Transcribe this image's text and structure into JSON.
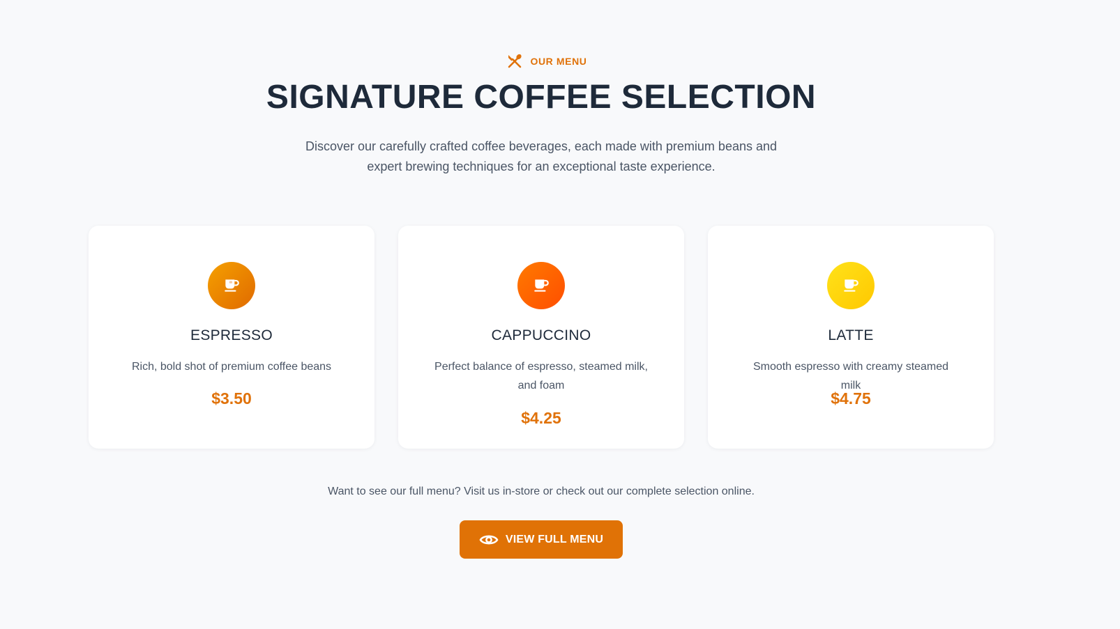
{
  "header": {
    "eyebrow_icon": "utensils-icon",
    "eyebrow": "OUR MENU",
    "title": "SIGNATURE COFFEE SELECTION",
    "subtitle": "Discover our carefully crafted coffee beverages, each made with premium beans and expert brewing techniques for an exceptional taste experience."
  },
  "menu": {
    "items": [
      {
        "icon": "coffee-cup-icon",
        "icon_colors": [
          "#f5a000",
          "#e06a00"
        ],
        "name": "ESPRESSO",
        "description": "Rich, bold shot of premium coffee beans",
        "price": "$3.50"
      },
      {
        "icon": "coffee-cup-icon",
        "icon_colors": [
          "#ff7a00",
          "#ff4e00"
        ],
        "name": "CAPPUCCINO",
        "description": "Perfect balance of espresso, steamed milk, and foam",
        "price": "$4.25"
      },
      {
        "icon": "coffee-cup-icon",
        "icon_colors": [
          "#ffe21a",
          "#ffc800"
        ],
        "name": "LATTE",
        "description": "Smooth espresso with creamy steamed milk",
        "price": "$4.75"
      }
    ]
  },
  "cta": {
    "text": "Want to see our full menu? Visit us in-store or check out our complete selection online.",
    "button_icon": "eye-icon",
    "button_label": "VIEW FULL MENU"
  },
  "colors": {
    "accent": "#e07206",
    "background": "#f8f9fb",
    "heading": "#1e2a3a",
    "body_text": "#4a5565"
  }
}
